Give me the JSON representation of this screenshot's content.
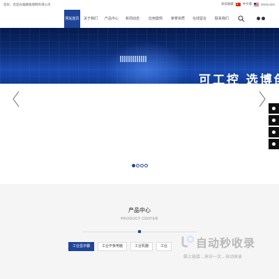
{
  "topbar": {
    "welcome": "您好，欢迎光临模板图网有限公司",
    "favorite": "添加收藏",
    "lang_cn": "中文版",
    "lang_en": "ENGLISH"
  },
  "nav": {
    "items": [
      "网站首页",
      "关于我们",
      "产品中心",
      "新闻动态",
      "应用案例",
      "荣誉资质",
      "在线留言",
      "联系我们"
    ],
    "active_index": 0
  },
  "banner": {
    "slogan": "可工控 选博创",
    "dots_total": 4,
    "dots_active": 0
  },
  "colors": {
    "brand": "#1e4597",
    "banner_dark": "#061a4a"
  },
  "products": {
    "title": "产品中心",
    "subtitle": "PRODUCT CENTER",
    "tabs": [
      "工业显示器",
      "工业平板电脑",
      "工业机器",
      "工业"
    ],
    "active_tab": 0
  },
  "watermark": {
    "title": "自动秒收录",
    "sub": "做上链接→来访一次→自动收录"
  }
}
